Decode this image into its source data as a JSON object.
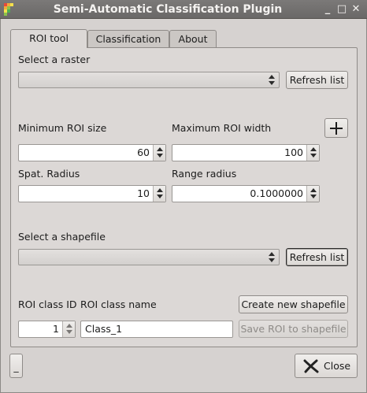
{
  "window": {
    "title": "Semi-Automatic Classification Plugin",
    "minimize_glyph": "_",
    "maximize_glyph": "□",
    "close_glyph": "✕"
  },
  "tabs": [
    {
      "label": "ROI tool",
      "active": true
    },
    {
      "label": "Classification",
      "active": false
    },
    {
      "label": "About",
      "active": false
    }
  ],
  "raster": {
    "label": "Select a raster",
    "selected": "",
    "refresh_label": "Refresh list"
  },
  "roi": {
    "min_size_label": "Minimum ROI size",
    "min_size_value": "60",
    "max_width_label": "Maximum ROI width",
    "max_width_value": "100",
    "add_glyph": "+",
    "spat_radius_label": "Spat. Radius",
    "spat_radius_value": "10",
    "range_radius_label": "Range radius",
    "range_radius_value": "0.1000000"
  },
  "shapefile": {
    "label": "Select a shapefile",
    "selected": "",
    "refresh_label": "Refresh list"
  },
  "roi_class": {
    "id_label": "ROI class ID",
    "name_label": "ROI class name",
    "create_label": "Create new shapefile",
    "id_value": "1",
    "name_value": "Class_1",
    "save_label": "Save ROI to shapefile"
  },
  "footer": {
    "toggle_label": "_",
    "close_label": "Close"
  },
  "colors": {
    "window_bg": "#d6d2d0",
    "titlebar": "#6f6d6c",
    "close_x": "#222222"
  }
}
